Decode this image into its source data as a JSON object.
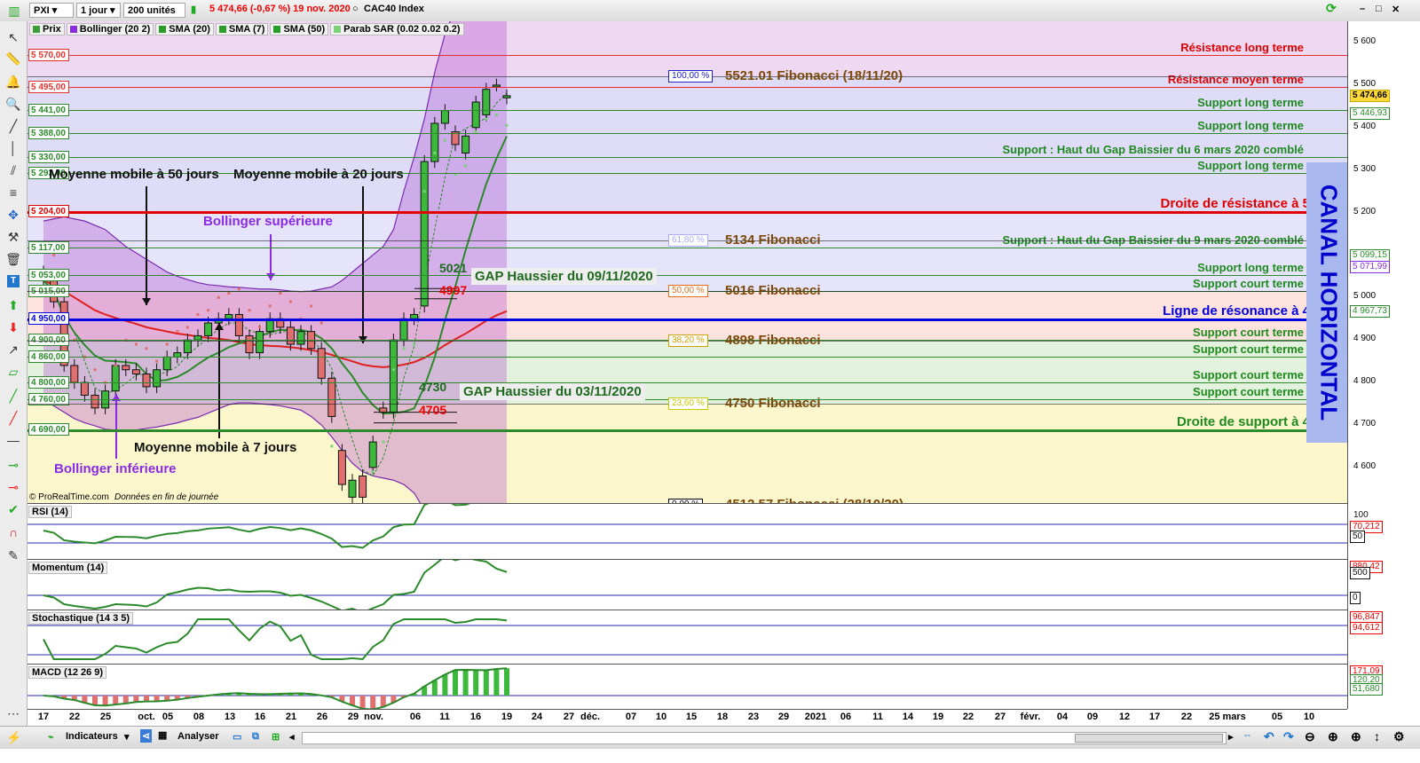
{
  "toolbar": {
    "symbol": "PXI",
    "period": "1 jour",
    "units": "200 unités",
    "price_info": "5 474,66 (-0,67 %) 19 nov. 2020",
    "instrument": "CAC40 Index"
  },
  "legend": [
    {
      "label": "Prix",
      "color": "#3c9f3c"
    },
    {
      "label": "Bollinger (20 2)",
      "color": "#8a2be2"
    },
    {
      "label": "SMA (20)",
      "color": "#2a9c2a"
    },
    {
      "label": "SMA (7)",
      "color": "#2a9c2a"
    },
    {
      "label": "SMA (50)",
      "color": "#2a9c2a"
    },
    {
      "label": "Parab SAR (0.02 0.02 0.2)",
      "color": "#7cd07c"
    }
  ],
  "price_levels": [
    {
      "label": "5 570,00",
      "value": 5570,
      "color": "#e53030",
      "text": "Résistance long terme",
      "text_color": "#e00000"
    },
    {
      "label": "5 495,00",
      "value": 5495,
      "color": "#e53030",
      "text": "Résistance moyen terme",
      "text_color": "#e00000"
    },
    {
      "label": "5 441,00",
      "value": 5441,
      "color": "#2d8a2d",
      "text": "Support long terme",
      "text_color": "#1f8a1f"
    },
    {
      "label": "5 388,00",
      "value": 5388,
      "color": "#2d8a2d",
      "text": "Support long terme",
      "text_color": "#1f8a1f"
    },
    {
      "label": "5 330,00",
      "value": 5330,
      "color": "#2d8a2d",
      "text": "Support : Haut du Gap Baissier du 6 mars 2020 comblé",
      "text_color": "#1f8a1f"
    },
    {
      "label": "5 293,00",
      "value": 5293,
      "color": "#2d8a2d",
      "text": "Support long terme",
      "text_color": "#1f8a1f"
    },
    {
      "label": "5 204,00",
      "value": 5204,
      "color": "#e00000",
      "text": "Droite de résistance à 5213",
      "text_color": "#e00000"
    },
    {
      "label": "5 117,00",
      "value": 5117,
      "color": "#2d8a2d",
      "text": "Support : Haut du Gap Baissier du 9 mars 2020 comblé",
      "text_color": "#1f8a1f"
    },
    {
      "label": "5 053,00",
      "value": 5053,
      "color": "#2d8a2d",
      "text": "Support long terme",
      "text_color": "#1f8a1f"
    },
    {
      "label": "5 015,00",
      "value": 5015,
      "color": "#2d8a2d",
      "text": "Support court terme",
      "text_color": "#1f8a1f"
    },
    {
      "label": "4 950,00",
      "value": 4950,
      "color": "#0000e0",
      "text": "Ligne de résonance à 4950",
      "text_color": "#0000e0"
    },
    {
      "label": "4 900,00",
      "value": 4900,
      "color": "#2d8a2d",
      "text": "Support court terme",
      "text_color": "#1f8a1f"
    },
    {
      "label": "4 860,00",
      "value": 4860,
      "color": "#2d8a2d",
      "text": "Support court terme",
      "text_color": "#1f8a1f"
    },
    {
      "label": "4 800,00",
      "value": 4800,
      "color": "#2d8a2d",
      "text": "Support court terme",
      "text_color": "#1f8a1f"
    },
    {
      "label": "4 760,00",
      "value": 4760,
      "color": "#2d8a2d",
      "text": "Support court terme",
      "text_color": "#1f8a1f"
    },
    {
      "label": "4 690,00",
      "value": 4690,
      "color": "#2d8a2d",
      "text": "Droite de support à 4690",
      "text_color": "#1f8a1f"
    }
  ],
  "fibonacci": [
    {
      "pct": "100,00 %",
      "value": 5521,
      "text": "5521.01 Fibonacci (18/11/20)",
      "box_color": "#2222cc"
    },
    {
      "pct": "61,80 %",
      "value": 5134,
      "text": "5134 Fibonacci",
      "box_color": "#aaaaff"
    },
    {
      "pct": "50,00 %",
      "value": 5016,
      "text": "5016 Fibonacci",
      "box_color": "#e07020"
    },
    {
      "pct": "38,20 %",
      "value": 4898,
      "text": "4898 Fibonacci",
      "box_color": "#d0a000"
    },
    {
      "pct": "23,60 %",
      "value": 4750,
      "text": "4750 Fibonacci",
      "box_color": "#c8c800"
    },
    {
      "pct": "0,00 %",
      "value": 4512,
      "text": "4512.57 Fibonacci (28/10/20)",
      "box_color": "#000000"
    }
  ],
  "annotations": {
    "ma50": "Moyenne mobile à 50 jours",
    "ma20": "Moyenne mobile à 20 jours",
    "ma7": "Moyenne mobile à 7 jours",
    "boll_sup": "Bollinger supérieure",
    "boll_inf": "Bollinger inférieure",
    "gap1": "GAP Haussier du 09/11/2020",
    "gap2": "GAP Haussier du 03/11/2020",
    "gap1_top": "5021",
    "gap1_bot": "4997",
    "gap2_top": "4730",
    "gap2_bot": "4705",
    "canal": "CANAL HORIZONTAL",
    "copyright": "© ProRealTime.com",
    "note": "Données en fin de journée"
  },
  "y_axis": {
    "ticks": [
      "5 600",
      "5 500",
      "5 400",
      "5 300",
      "5 200",
      "5 100",
      "5 000",
      "4 900",
      "4 800",
      "4 700",
      "4 600"
    ],
    "last_price": "5 474,66",
    "badges": [
      "5 446,93",
      "5 099,15",
      "5 071,99",
      "4 967,73"
    ]
  },
  "indicators": [
    {
      "name": "RSI (14)",
      "levels": [
        "100",
        "70,212",
        "50"
      ]
    },
    {
      "name": "Momentum (14)",
      "levels": [
        "880,42",
        "500",
        "0"
      ]
    },
    {
      "name": "Stochastique (14 3 5)",
      "levels": [
        "96,847",
        "94,612"
      ]
    },
    {
      "name": "MACD (12 26 9)",
      "levels": [
        "171,09",
        "120,20",
        "51,680"
      ]
    }
  ],
  "x_axis": [
    "17",
    "22",
    "25",
    "oct.",
    "05",
    "08",
    "13",
    "16",
    "21",
    "26",
    "29",
    "nov.",
    "06",
    "11",
    "16",
    "19",
    "24",
    "27",
    "déc.",
    "07",
    "10",
    "15",
    "18",
    "23",
    "29",
    "2021",
    "06",
    "11",
    "14",
    "19",
    "22",
    "27",
    "févr.",
    "04",
    "09",
    "12",
    "17",
    "22",
    "25 mars",
    "05",
    "10"
  ],
  "bottom": {
    "indicators_label": "Indicateurs",
    "analyse_label": "Analyser"
  },
  "chart_data": {
    "type": "candlestick",
    "instrument": "CAC40 Index",
    "x": [
      "17/09",
      "18/09",
      "21/09",
      "22/09",
      "23/09",
      "24/09",
      "25/09",
      "28/09",
      "29/09",
      "30/09",
      "01/10",
      "02/10",
      "05/10",
      "06/10",
      "07/10",
      "08/10",
      "09/10",
      "12/10",
      "13/10",
      "14/10",
      "15/10",
      "16/10",
      "19/10",
      "20/10",
      "21/10",
      "22/10",
      "23/10",
      "26/10",
      "27/10",
      "28/10",
      "29/10",
      "30/10",
      "02/11",
      "03/11",
      "04/11",
      "05/11",
      "06/11",
      "09/11",
      "10/11",
      "11/11",
      "12/11",
      "13/11",
      "16/11",
      "17/11",
      "18/11",
      "19/11"
    ],
    "open": [
      5060,
      5040,
      4990,
      4840,
      4800,
      4770,
      4740,
      4780,
      4840,
      4830,
      4820,
      4790,
      4830,
      4860,
      4870,
      4900,
      4910,
      4940,
      4950,
      4960,
      4910,
      4870,
      4920,
      4950,
      4930,
      4890,
      4920,
      4880,
      4810,
      4640,
      4530,
      4580,
      4600,
      4740,
      4730,
      4900,
      4950,
      4980,
      5320,
      5410,
      5390,
      5340,
      5400,
      5430,
      5500,
      5470
    ],
    "close": [
      5040,
      4990,
      4840,
      4800,
      4770,
      4740,
      4780,
      4840,
      4830,
      4820,
      4790,
      4830,
      4860,
      4870,
      4900,
      4910,
      4940,
      4950,
      4960,
      4910,
      4870,
      4920,
      4950,
      4930,
      4890,
      4920,
      4880,
      4810,
      4720,
      4560,
      4570,
      4530,
      4660,
      4730,
      4900,
      4950,
      4960,
      5320,
      5410,
      5440,
      5360,
      5380,
      5460,
      5490,
      5500,
      5475
    ],
    "sma50": [
      5040,
      5030,
      5015,
      5000,
      4985,
      4970,
      4960,
      4952,
      4945,
      4938,
      4930,
      4925,
      4920,
      4915,
      4912,
      4908,
      4905,
      4903,
      4900,
      4895,
      4890,
      4888,
      4886,
      4885,
      4883,
      4880,
      4876,
      4872,
      4865,
      4857,
      4850,
      4842,
      4838,
      4836,
      4838,
      4842,
      4848,
      4858,
      4872,
      4888,
      4902,
      4915,
      4930,
      4945,
      4958,
      4968
    ],
    "bollinger_upper": [
      5180,
      5185,
      5190,
      5185,
      5180,
      5170,
      5160,
      5140,
      5120,
      5105,
      5090,
      5075,
      5060,
      5050,
      5042,
      5035,
      5030,
      5028,
      5025,
      5024,
      5022,
      5020,
      5020,
      5018,
      5015,
      5014,
      5015,
      5020,
      5025,
      5040,
      5060,
      5080,
      5100,
      5120,
      5160,
      5250,
      5330,
      5420,
      5530,
      5620,
      5680,
      5740,
      5790,
      5830,
      5860,
      5880
    ],
    "bollinger_lower": [
      4760,
      4745,
      4730,
      4715,
      4705,
      4698,
      4690,
      4688,
      4686,
      4688,
      4692,
      4695,
      4700,
      4705,
      4712,
      4718,
      4728,
      4738,
      4748,
      4752,
      4752,
      4750,
      4748,
      4745,
      4740,
      4735,
      4720,
      4700,
      4672,
      4640,
      4610,
      4590,
      4580,
      4575,
      4570,
      4560,
      4540,
      4500,
      4470,
      4440,
      4420,
      4400,
      4380,
      4360,
      4345,
      4340
    ],
    "ylim": [
      4545,
      5670
    ]
  }
}
